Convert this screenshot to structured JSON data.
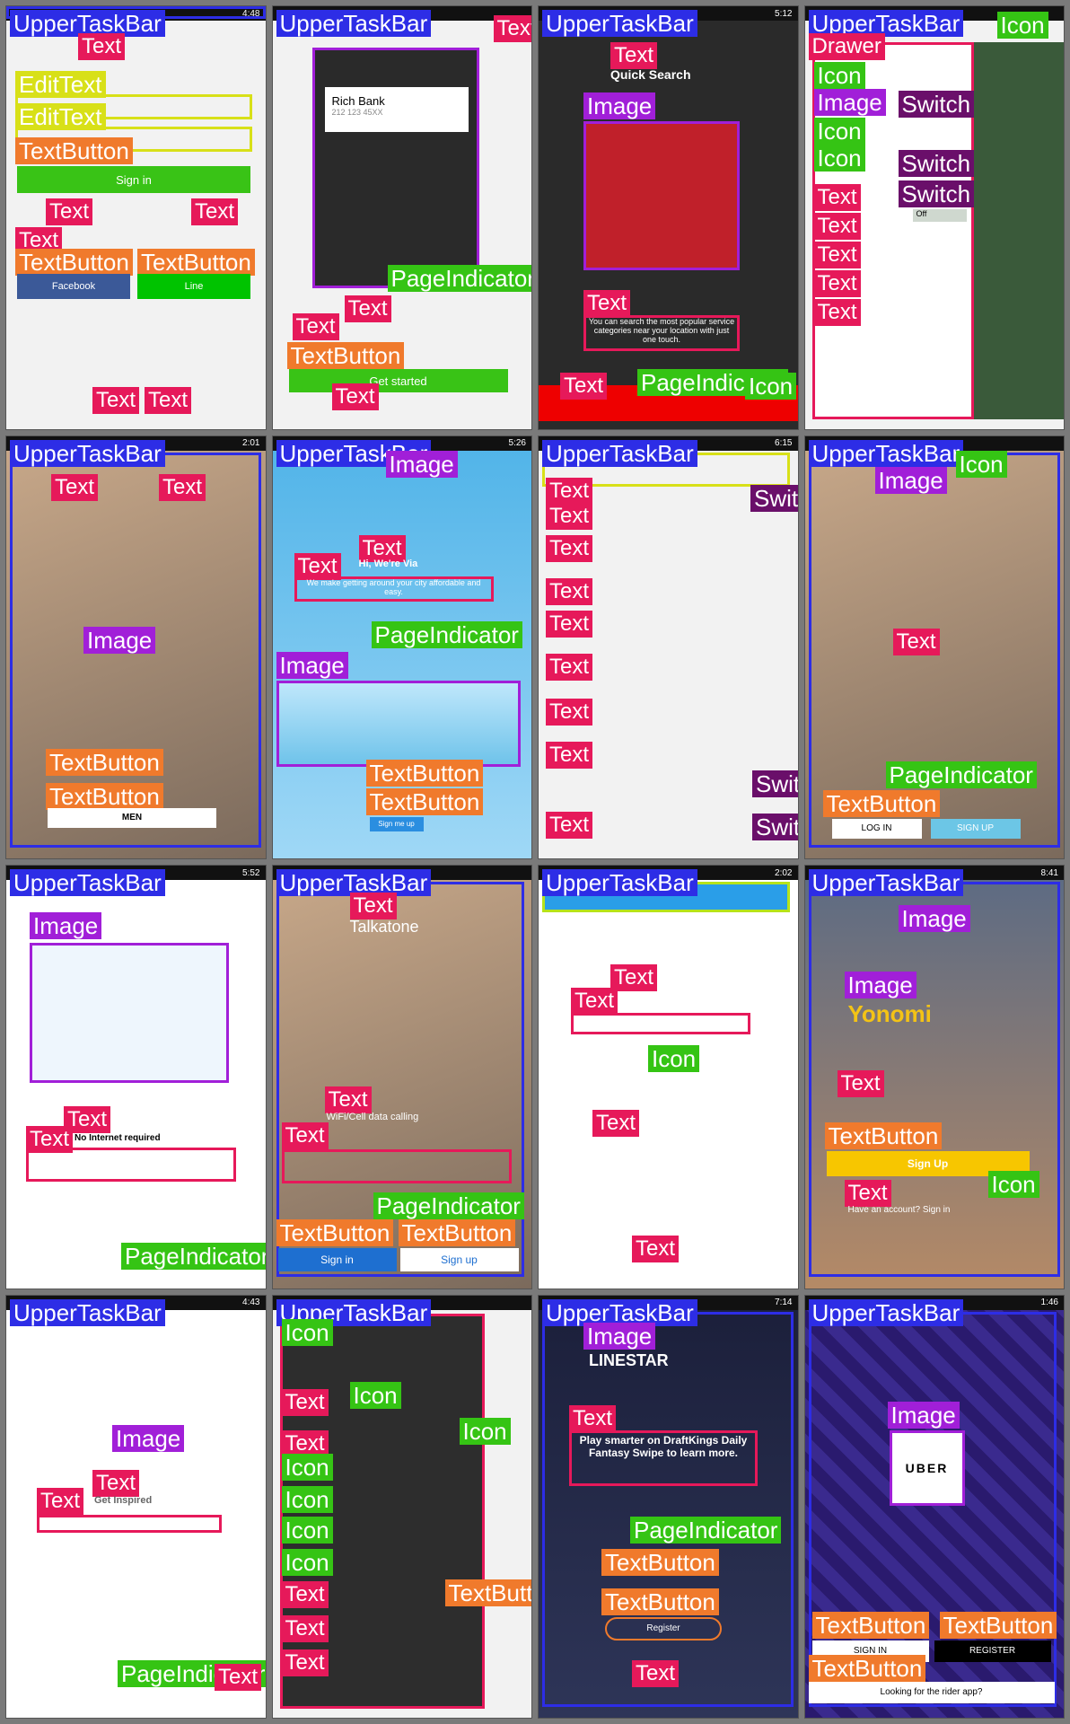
{
  "labels": {
    "upper_task_bar": "UpperTaskBar",
    "text": "Text",
    "text_button": "TextButton",
    "image": "Image",
    "page_indicator": "PageIndicator",
    "icon": "Icon",
    "switch": "Switch",
    "edit_text": "EditText",
    "background_image": "BackgroundImage",
    "drawer": "Drawer",
    "toolbar": "Toolbar"
  },
  "screens": [
    {
      "status_time": "4:48",
      "sign_in": "Sign in",
      "facebook": "Facebook",
      "line": "Line"
    },
    {
      "status_time": "",
      "caller": "Rich Bank",
      "caller_number": "212 123 45XX",
      "get_started": "Get started"
    },
    {
      "status_time": "5:12",
      "heading": "Quick Search",
      "body": "You can search the most popular service categories near your location with just one touch."
    },
    {
      "status_time": "",
      "switch_off": "Off"
    },
    {
      "status_time": "2:01",
      "menu_button": "MEN"
    },
    {
      "status_time": "5:26",
      "headline": "Hi, We're Via",
      "body": "We make getting around your city affordable and easy.",
      "signup": "Sign me up"
    },
    {
      "status_time": "6:15"
    },
    {
      "status_time": "",
      "login": "LOG IN",
      "signup": "SIGN UP"
    },
    {
      "status_time": "5:52",
      "heading": "No Internet required"
    },
    {
      "status_time": "",
      "brand": "Talkatone",
      "caption": "WiFi/Cell data calling",
      "sign_in": "Sign in",
      "sign_up": "Sign up"
    },
    {
      "status_time": "2:02"
    },
    {
      "status_time": "8:41",
      "brand": "Yonomi",
      "signup": "Sign Up",
      "login_prompt": "Have an account? Sign in"
    },
    {
      "status_time": "4:43",
      "heading": "Get Inspired"
    },
    {
      "status_time": ""
    },
    {
      "status_time": "7:14",
      "brand": "LINESTAR",
      "body": "Play smarter on DraftKings Daily Fantasy Swipe to learn more.",
      "register": "Register"
    },
    {
      "status_time": "1:46",
      "brand": "UBER",
      "sign_in": "SIGN IN",
      "register": "REGISTER",
      "rider": "Looking for the rider app?"
    }
  ]
}
